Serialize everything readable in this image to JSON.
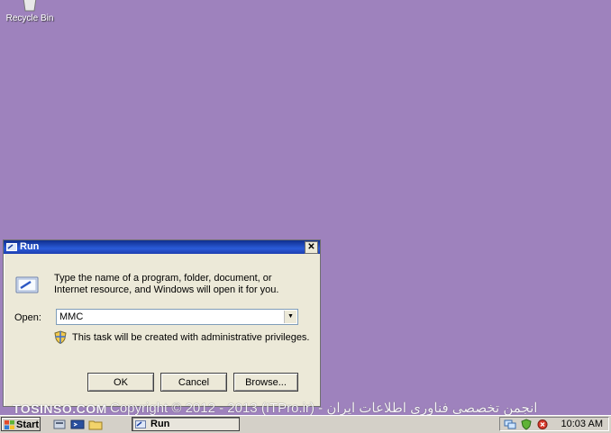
{
  "desktop": {
    "recycle_bin_label": "Recycle Bin",
    "background_color": "#9e82bd"
  },
  "run_dialog": {
    "title": "Run",
    "description": "Type the name of a program, folder, document, or Internet resource, and Windows will open it for you.",
    "open_label": "Open:",
    "open_value": "MMC",
    "admin_note": "This task will be created with administrative privileges.",
    "ok_label": "OK",
    "cancel_label": "Cancel",
    "browse_label": "Browse..."
  },
  "watermark": {
    "site": "TOSINSO.COM",
    "copyright": "Copyright © 2012 - 2013 (ITPro.ir) - انجمن تخصصی فناوری اطلاعات ایران"
  },
  "taskbar": {
    "start_label": "Start",
    "task_run_label": "Run",
    "clock": "10:03 AM"
  }
}
